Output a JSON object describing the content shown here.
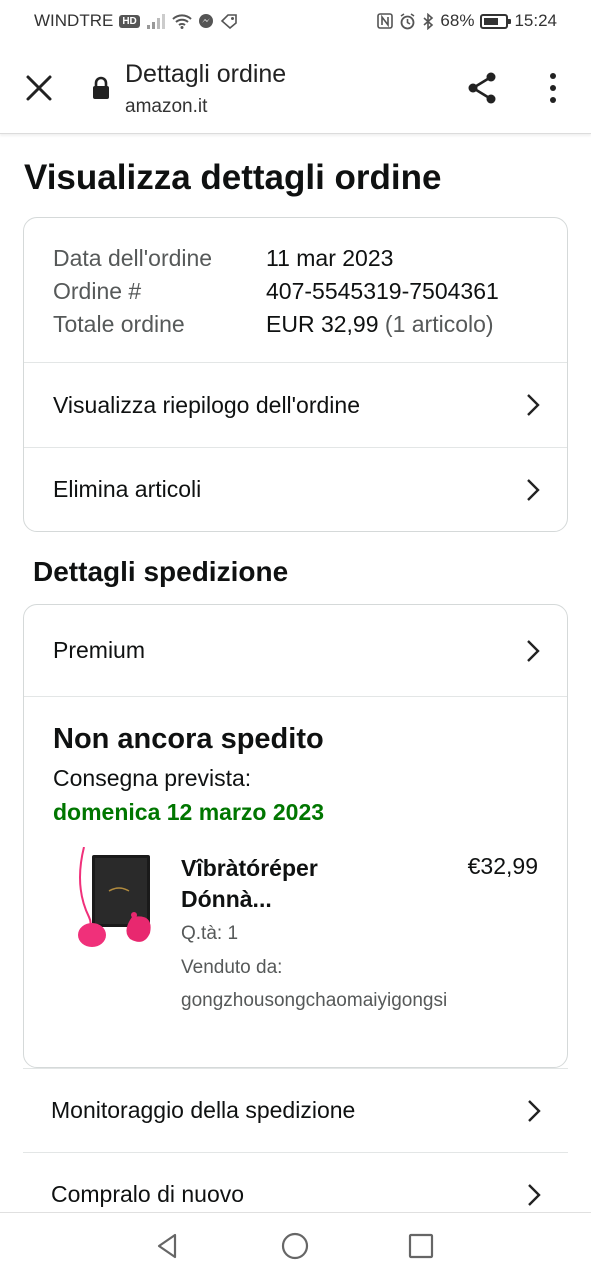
{
  "status_bar": {
    "carrier": "WINDTRE",
    "carrier_badge": "HD",
    "battery": "68%",
    "battery_level": 0.68,
    "time": "15:24"
  },
  "browser": {
    "title": "Dettagli ordine",
    "host": "amazon.it",
    "icons": [
      "close-icon",
      "lock-icon",
      "share-icon",
      "more-vert-icon"
    ]
  },
  "page": {
    "title": "Visualizza dettagli ordine"
  },
  "order_info": {
    "rows": [
      {
        "key": "Data dell'ordine",
        "value": "11 mar 2023",
        "extra": ""
      },
      {
        "key": "Ordine #",
        "value": "407-5545319-7504361",
        "extra": ""
      },
      {
        "key": "Totale ordine",
        "value": "EUR 32,99",
        "extra": "(1 articolo)"
      }
    ],
    "links": [
      {
        "label": "Visualizza riepilogo dell'ordine"
      },
      {
        "label": "Elimina articoli"
      }
    ]
  },
  "shipping": {
    "section_title": "Dettagli spedizione",
    "service": "Premium",
    "status": "Non ancora spedito",
    "delivery_label": "Consegna prevista:",
    "delivery_date": "domenica 12 marzo 2023",
    "item": {
      "name_line1": "Vîbràtóréper",
      "name_line2": "Dónnà...",
      "price": "€32,99",
      "qty": "Q.tà: 1",
      "sold_by_label": "Venduto da:",
      "seller": "gongzhousongchaomaiyigongsi"
    }
  },
  "bottom_links": [
    {
      "label": "Monitoraggio della spedizione"
    },
    {
      "label": "Compralo di nuovo"
    }
  ],
  "nav": {
    "icons": [
      "back-triangle-icon",
      "home-circle-icon",
      "recents-square-icon"
    ]
  },
  "colors": {
    "delivery_green": "#007600",
    "text": "#0f1111",
    "muted": "#565959",
    "border": "#d5d9d9",
    "product_pink": "#f0307a"
  }
}
